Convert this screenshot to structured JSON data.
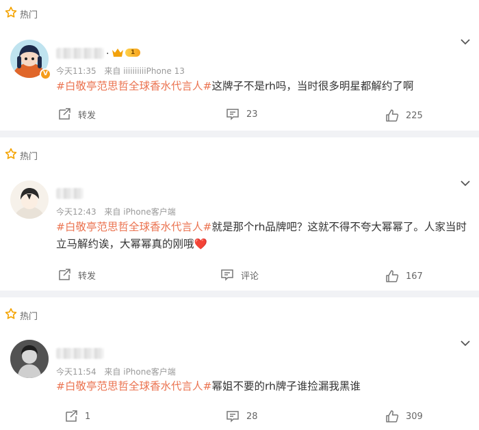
{
  "hot_label": "热门",
  "comments": [
    {
      "badge_level": "1",
      "name_suffix": ".",
      "time": "今天11:35",
      "source": "来自 iiiiiiiiiiPhone 13",
      "topic": "#白敬亭范思哲全球香水代言人#",
      "body": "这牌子不是rh吗，当时很多明星都解约了啊",
      "repost": "转发",
      "comments": "23",
      "likes": "225"
    },
    {
      "time": "今天12:43",
      "source": "来自 iPhone客户端",
      "topic": "#白敬亭范思哲全球香水代言人#",
      "body": "就是那个rh品牌吧？这就不得不夸大幂幂了。人家当时立马解约诶，大幂幂真的刚哦",
      "emoji": "❤️",
      "repost": "转发",
      "comments": "评论",
      "likes": "167"
    },
    {
      "time": "今天11:54",
      "source": "来自 iPhone客户端",
      "topic": "#白敬亭范思哲全球香水代言人#",
      "body": "幂姐不要的rh牌子谁捡漏我黑谁",
      "repost": "1",
      "comments": "28",
      "likes": "309"
    }
  ],
  "colors": {
    "topic": "#eb7350",
    "hot_star": "#f4a300",
    "divider": "#f1f2f5"
  },
  "icons": [
    "hot-star-icon",
    "chevron-down-icon",
    "repost-icon",
    "comment-icon",
    "like-icon",
    "crown-icon",
    "verified-badge-icon"
  ]
}
